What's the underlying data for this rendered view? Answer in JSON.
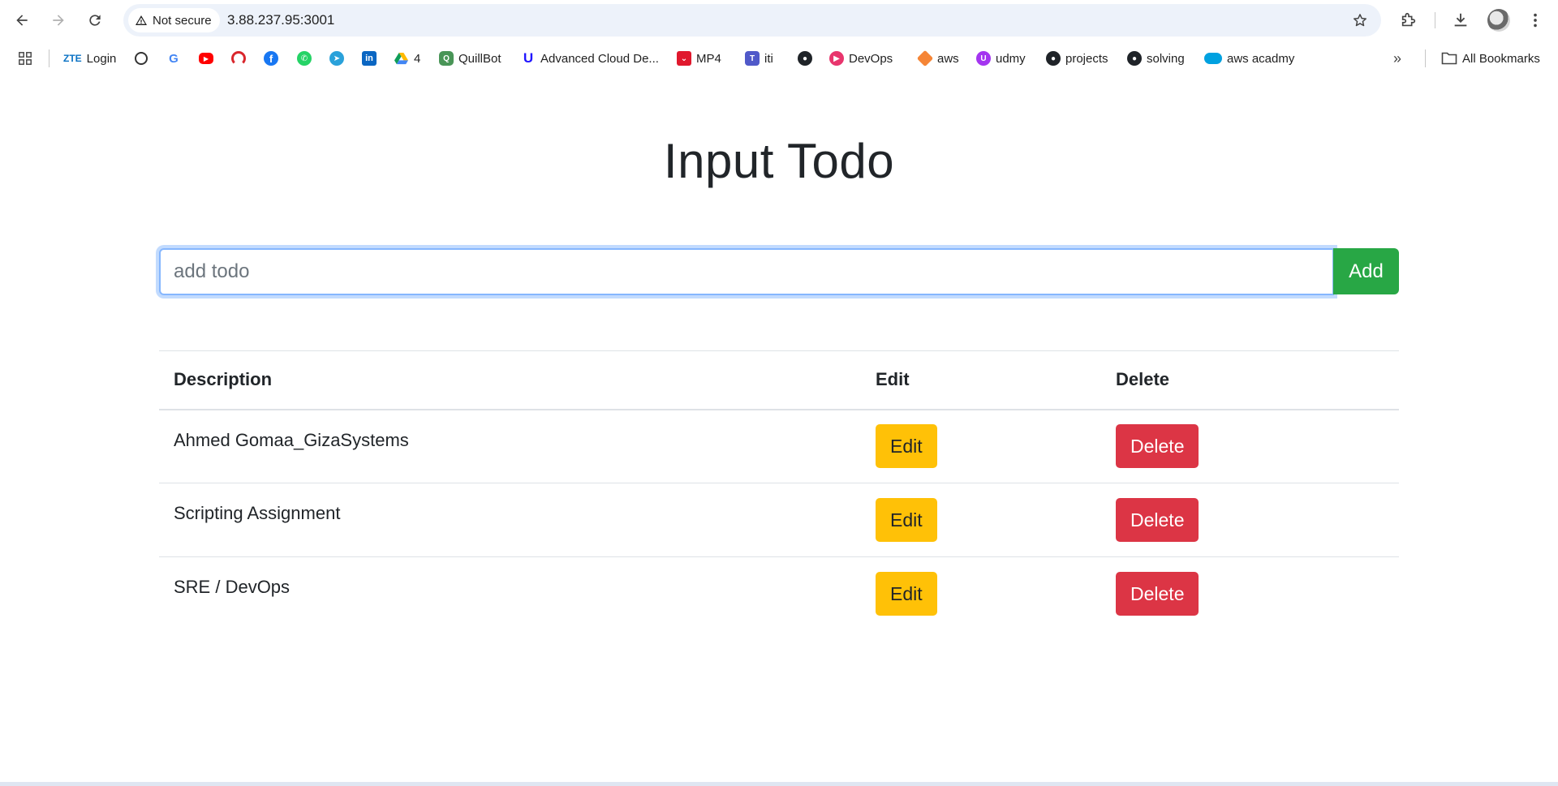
{
  "browser": {
    "security_label": "Not secure",
    "url": "3.88.237.95:3001",
    "bookmarks": [
      {
        "label": "Login",
        "icon": "zte-icon"
      },
      {
        "label": "",
        "icon": "chatgpt-icon"
      },
      {
        "label": "",
        "icon": "google-icon"
      },
      {
        "label": "",
        "icon": "youtube-icon"
      },
      {
        "label": "",
        "icon": "speedometer-icon"
      },
      {
        "label": "",
        "icon": "facebook-icon"
      },
      {
        "label": "",
        "icon": "whatsapp-icon"
      },
      {
        "label": "",
        "icon": "telegram-icon"
      },
      {
        "label": "",
        "icon": "linkedin-icon"
      },
      {
        "label": "4",
        "icon": "google-drive-icon"
      },
      {
        "label": "QuillBot",
        "icon": "quillbot-icon"
      },
      {
        "label": "Advanced Cloud De...",
        "icon": "udacity-icon"
      },
      {
        "label": "MP4",
        "icon": "mp4-icon"
      },
      {
        "label": "iti",
        "icon": "teams-icon"
      },
      {
        "label": "",
        "icon": "github-icon"
      },
      {
        "label": "DevOps",
        "icon": "devops-icon"
      },
      {
        "label": "aws",
        "icon": "aws-icon"
      },
      {
        "label": "udmy",
        "icon": "udemy-icon"
      },
      {
        "label": "projects",
        "icon": "github-icon"
      },
      {
        "label": "solving",
        "icon": "github-icon"
      },
      {
        "label": "aws acadmy",
        "icon": "salesforce-icon"
      }
    ],
    "all_bookmarks_label": "All Bookmarks"
  },
  "page": {
    "title": "Input Todo",
    "input_placeholder": "add todo",
    "add_label": "Add",
    "table": {
      "headers": [
        "Description",
        "Edit",
        "Delete"
      ],
      "rows": [
        {
          "description": "Ahmed Gomaa_GizaSystems",
          "edit": "Edit",
          "delete": "Delete"
        },
        {
          "description": "Scripting Assignment",
          "edit": "Edit",
          "delete": "Delete"
        },
        {
          "description": "SRE / DevOps",
          "edit": "Edit",
          "delete": "Delete"
        }
      ]
    }
  },
  "colors": {
    "add": "#28a745",
    "edit": "#ffc107",
    "delete": "#dc3545",
    "focus_border": "#86b7fe"
  }
}
